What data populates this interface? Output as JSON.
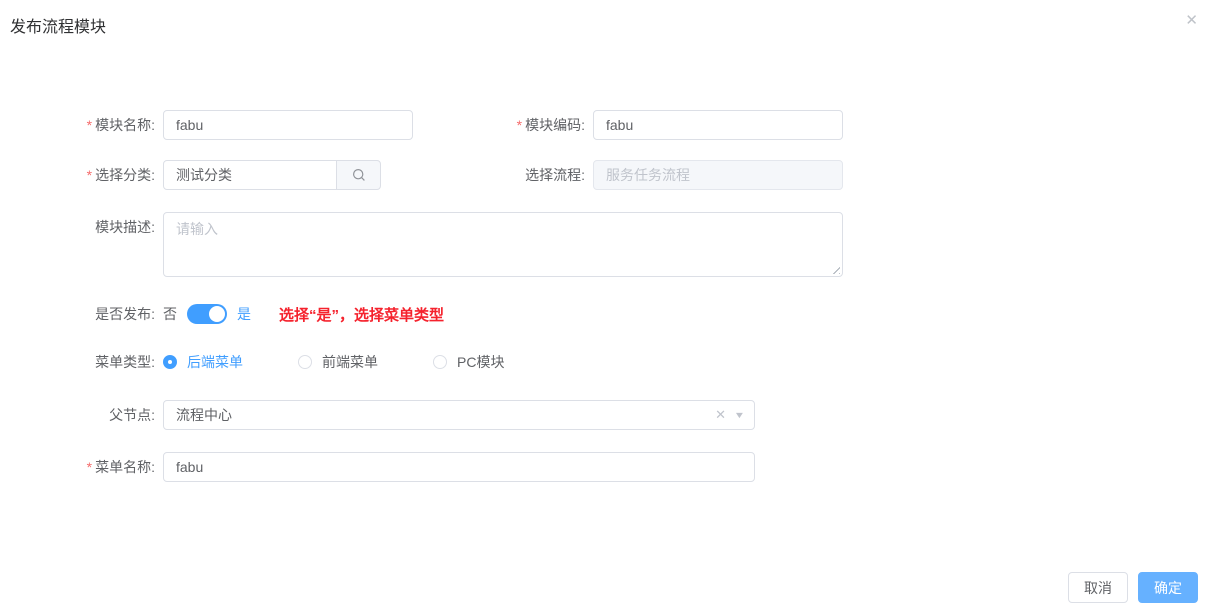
{
  "ui": {
    "required_marker": "*"
  },
  "icons": {
    "close": "✕",
    "clear": "✕",
    "caret": "▼"
  },
  "colors": {
    "accent": "#409eff",
    "danger_text": "#f5222d",
    "confirm_button": "#66b1ff",
    "input_border": "#dcdfe6"
  },
  "dialog": {
    "title": "发布流程模块"
  },
  "form": {
    "module_name": {
      "label": "模块名称:",
      "value": "fabu"
    },
    "module_code": {
      "label": "模块编码:",
      "value": "fabu"
    },
    "category": {
      "label": "选择分类:",
      "value": "测试分类"
    },
    "process": {
      "label": "选择流程:",
      "placeholder": "服务任务流程"
    },
    "description": {
      "label": "模块描述:",
      "placeholder": "请输入"
    },
    "publish": {
      "label": "是否发布:",
      "off_label": "否",
      "on_label": "是",
      "state": "on",
      "hint": "选择“是”，选择菜单类型"
    },
    "menu_type": {
      "label": "菜单类型:",
      "options": [
        {
          "label": "后端菜单",
          "selected": true
        },
        {
          "label": "前端菜单",
          "selected": false
        },
        {
          "label": "PC模块",
          "selected": false
        }
      ]
    },
    "parent_node": {
      "label": "父节点:",
      "value": "流程中心"
    },
    "menu_name": {
      "label": "菜单名称:",
      "value": "fabu"
    }
  },
  "footer": {
    "cancel_label": "取消",
    "confirm_label": "确定"
  }
}
